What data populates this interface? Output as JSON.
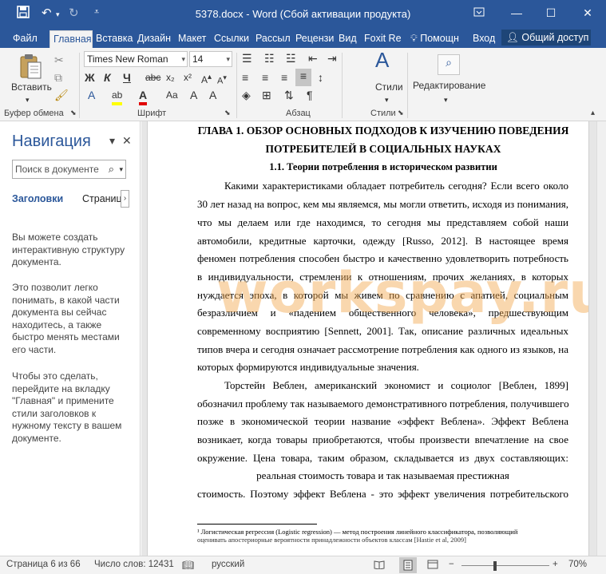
{
  "window": {
    "title": "5378.docx - Word (Сбой активации продукта)",
    "quick_access": {
      "save_icon": "save-icon",
      "undo_icon": "undo-icon",
      "redo_icon": "redo-icon",
      "customize_icon": "customize-icon"
    },
    "controls": {
      "ribbon_display": "ribbon-display-icon",
      "minimize": "minimize-icon",
      "restore": "restore-icon",
      "close": "close-icon"
    }
  },
  "ribbon_tabs": [
    {
      "label": "Файл"
    },
    {
      "label": "Главная",
      "active": true
    },
    {
      "label": "Вставка"
    },
    {
      "label": "Дизайн"
    },
    {
      "label": "Макет"
    },
    {
      "label": "Ссылки"
    },
    {
      "label": "Рассыл"
    },
    {
      "label": "Рецензи"
    },
    {
      "label": "Вид"
    },
    {
      "label": "Foxit Re"
    }
  ],
  "tell_me": "Помощн",
  "sign_in": "Вход",
  "share": "Общий доступ",
  "ribbon": {
    "clipboard": {
      "paste_label": "Вставить",
      "group_label": "Буфер обмена"
    },
    "font": {
      "name": "Times New Roman",
      "size": "14",
      "group_label": "Шрифт"
    },
    "paragraph": {
      "group_label": "Абзац"
    },
    "styles": {
      "label": "Стили",
      "group_label": "Стили"
    },
    "editing": {
      "label": "Редактирование"
    }
  },
  "navigation": {
    "title": "Навигация",
    "search_placeholder": "Поиск в документе",
    "tabs": [
      "Заголовки",
      "Страниц"
    ],
    "help_paragraphs": [
      "Вы можете создать интерактивную структуру документа.",
      "Это позволит легко понимать, в какой части документа вы сейчас находитесь, а также быстро менять местами его части.",
      "Чтобы это сделать, перейдите на вкладку \"Главная\" и примените стили заголовков к нужному тексту в вашем документе."
    ]
  },
  "document": {
    "heading_line1": "ГЛАВА 1. ОБЗОР ОСНОВНЫХ ПОДХОДОВ К ИЗУЧЕНИЮ ПОВЕДЕНИЯ",
    "heading_line2": "ПОТРЕБИТЕЛЕЙ В СОЦИАЛЬНЫХ НАУКАХ",
    "subheading": "1.1. Теории потребления в историческом развитии",
    "lines": [
      "Какими характеристиками обладает потребитель сегодня? Если всего около",
      "30 лет назад на вопрос, кем мы являемся, мы могли ответить, исходя из понимания,",
      "что мы делаем или где находимся, то сегодня мы представляем собой наши",
      "автомобили, кредитные карточки, одежду [Russo, 2012]. В настоящее время",
      "феномен потребления способен быстро и качественно удовлетворить потребность",
      "в индивидуальности, стремлении к отношениям, прочих желаниях, в которых",
      "нуждается эпоха, в которой мы живем по сравнению с апатией, социальным",
      "безразличием и «падением общественного человека», предшествующим",
      "современному восприятию [Sennett, 2001]. Так, описание различных идеальных",
      "типов вчера и сегодня означает рассмотрение потребления как одного из языков, на",
      "которых формируются индивидуальные значения.",
      "Торстейн Веблен, американский экономист и социолог [Веблен, 1899]",
      "обозначил проблему так называемого демонстративного потребления, получившего",
      "позже в экономической теории название «эффект Веблена». Эффект Веблена",
      "возникает, когда товары приобретаются, чтобы произвести впечатление на свое",
      "окружение. Цена товара, таким образом, складывается из двух составляющих:",
      "реальная стоимость товара и так называемая престижная",
      "стоимость. Поэтому эффект Веблена - это эффект увеличения потребительского"
    ],
    "footnote": "¹ Логистическая регрессия (Logistic regression) — метод построения линейного классификатора, позволяющий",
    "footnote_cont": "оценивать апостериорные вероятности принадлежности объектов классам [Hastie et al, 2009]",
    "watermark": "workspay.ru"
  },
  "status_bar": {
    "page": "Страница 6 из 66",
    "words": "Число слов: 12431",
    "language": "русский",
    "zoom": "70%"
  },
  "colors": {
    "accent": "#2b579a",
    "watermark": "#f2a74c"
  }
}
